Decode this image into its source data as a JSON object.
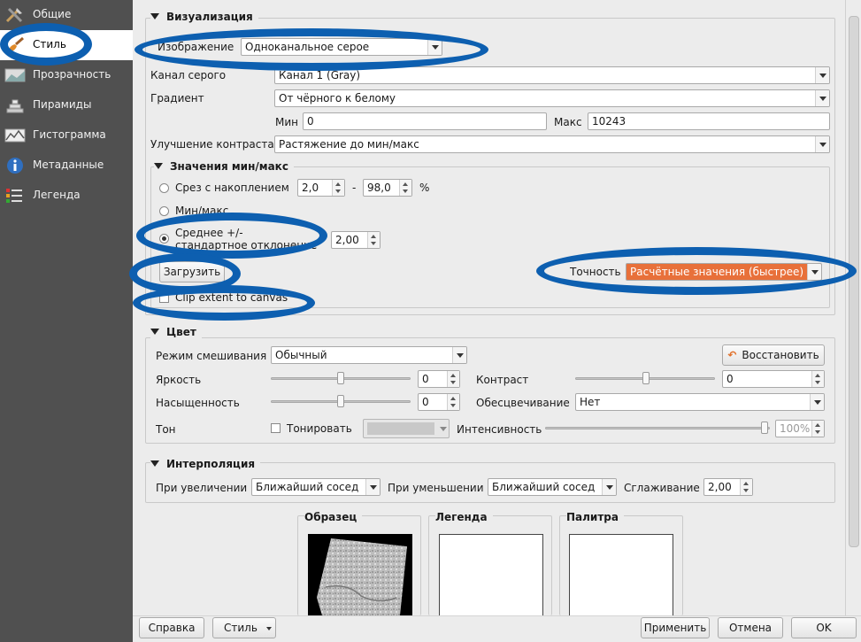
{
  "sidebar": {
    "items": [
      {
        "label": "Общие",
        "icon": "tools-icon"
      },
      {
        "label": "Стиль",
        "icon": "brush-icon"
      },
      {
        "label": "Прозрачность",
        "icon": "transparency-icon"
      },
      {
        "label": "Пирамиды",
        "icon": "pyramid-icon"
      },
      {
        "label": "Гистограмма",
        "icon": "histogram-icon"
      },
      {
        "label": "Метаданные",
        "icon": "info-icon"
      },
      {
        "label": "Легенда",
        "icon": "legend-icon"
      }
    ]
  },
  "visualization": {
    "title": "Визуализация",
    "render_type_label": "Изображение",
    "render_type_value": "Одноканальное серое",
    "gray_band_label": "Канал серого",
    "gray_band_value": "Канал 1 (Gray)",
    "gradient_label": "Градиент",
    "gradient_value": "От чёрного к белому",
    "min_label": "Мин",
    "min_value": "0",
    "max_label": "Макс",
    "max_value": "10243",
    "contrast_enh_label": "Улучшение контраста",
    "contrast_enh_value": "Растяжение до мин/макс"
  },
  "minmax": {
    "title": "Значения мин/макс",
    "cumulative_label": "Срез с накоплением",
    "cumulative_low": "2,0",
    "cumulative_sep": "-",
    "cumulative_high": "98,0",
    "cumulative_unit": "%",
    "minmax_label": "Мин/макс",
    "stddev_label_line1": "Среднее +/-",
    "stddev_label_line2": "стандартное отклонение",
    "stddev_value": "2,00",
    "load_button": "Загрузить",
    "accuracy_label": "Точность",
    "accuracy_value": "Расчётные значения (быстрее)",
    "clip_label": "Clip extent to canvas"
  },
  "color": {
    "title": "Цвет",
    "blend_label": "Режим смешивания",
    "blend_value": "Обычный",
    "reset_button": "Восстановить",
    "brightness_label": "Яркость",
    "brightness_value": "0",
    "contrast_label": "Контраст",
    "contrast_value": "0",
    "saturation_label": "Насыщенность",
    "saturation_value": "0",
    "grayscale_label": "Обесцвечивание",
    "grayscale_value": "Нет",
    "hue_label": "Тон",
    "colorize_label": "Тонировать",
    "strength_label": "Интенсивность",
    "strength_value": "100%"
  },
  "interpolation": {
    "title": "Интерполяция",
    "zoomin_label": "При увеличении",
    "zoomin_value": "Ближайший сосед",
    "zoomout_label": "При уменьшении",
    "zoomout_value": "Ближайший сосед",
    "oversampling_label": "Сглаживание",
    "oversampling_value": "2,00"
  },
  "previews": {
    "sample_title": "Образец",
    "legend_title": "Легенда",
    "palette_title": "Палитра"
  },
  "footer": {
    "help": "Справка",
    "style": "Стиль",
    "apply": "Применить",
    "cancel": "Отмена",
    "ok": "OK"
  },
  "colors": {
    "highlight_ellipse": "#0d5fb0",
    "accuracy_selected_bg": "#e8703a",
    "sidebar_bg": "#505050"
  }
}
